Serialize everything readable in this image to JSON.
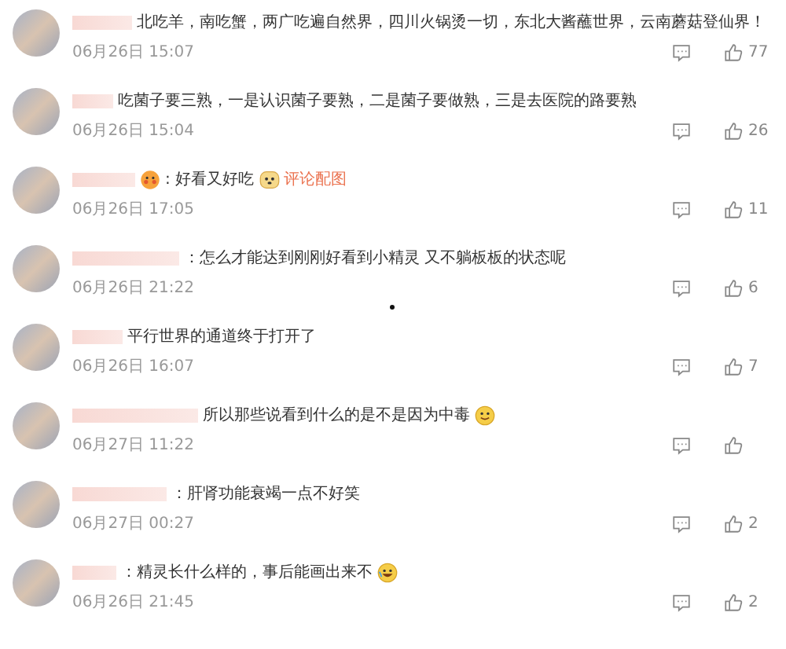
{
  "comments": [
    {
      "parts": [
        {
          "kind": "text",
          "text": "北吃羊，南吃蟹，两广吃遍自然界，四川火锅烫一切，东北大酱蘸世界，云南蘑菇登仙界！"
        }
      ],
      "date": "06月26日 15:07",
      "likes": "77"
    },
    {
      "parts": [
        {
          "kind": "text",
          "text": "吃菌子要三熟，一是认识菌子要熟，二是菌子要做熟，三是去医院的路要熟"
        }
      ],
      "date": "06月26日 15:04",
      "likes": "26"
    },
    {
      "parts": [
        {
          "kind": "blush"
        },
        {
          "kind": "text",
          "text": ": 好看又好吃"
        },
        {
          "kind": "dog"
        },
        {
          "kind": "link",
          "text": "评论配图"
        }
      ],
      "date": "06月26日 17:05",
      "likes": "11"
    },
    {
      "parts": [
        {
          "kind": "text",
          "text": "：怎么才能达到刚刚好看到小精灵 又不躺板板的状态呢"
        }
      ],
      "date": "06月26日 21:22",
      "likes": "6"
    },
    {
      "parts": [
        {
          "kind": "text",
          "text": "平行世界的通道终于打开了"
        }
      ],
      "date": "06月26日 16:07",
      "likes": "7"
    },
    {
      "parts": [
        {
          "kind": "text",
          "text": "所以那些说看到什么的是不是因为中毒"
        },
        {
          "kind": "smile"
        }
      ],
      "date": "06月27日 11:22"
    },
    {
      "parts": [
        {
          "kind": "text",
          "text": "：肝肾功能衰竭一点不好笑"
        }
      ],
      "date": "06月27日 00:27",
      "likes": "2"
    },
    {
      "parts": [
        {
          "kind": "text",
          "text": "：精灵长什么样的，事后能画出来不"
        },
        {
          "kind": "laugh"
        }
      ],
      "date": "06月26日 21:45",
      "likes": "2"
    }
  ]
}
